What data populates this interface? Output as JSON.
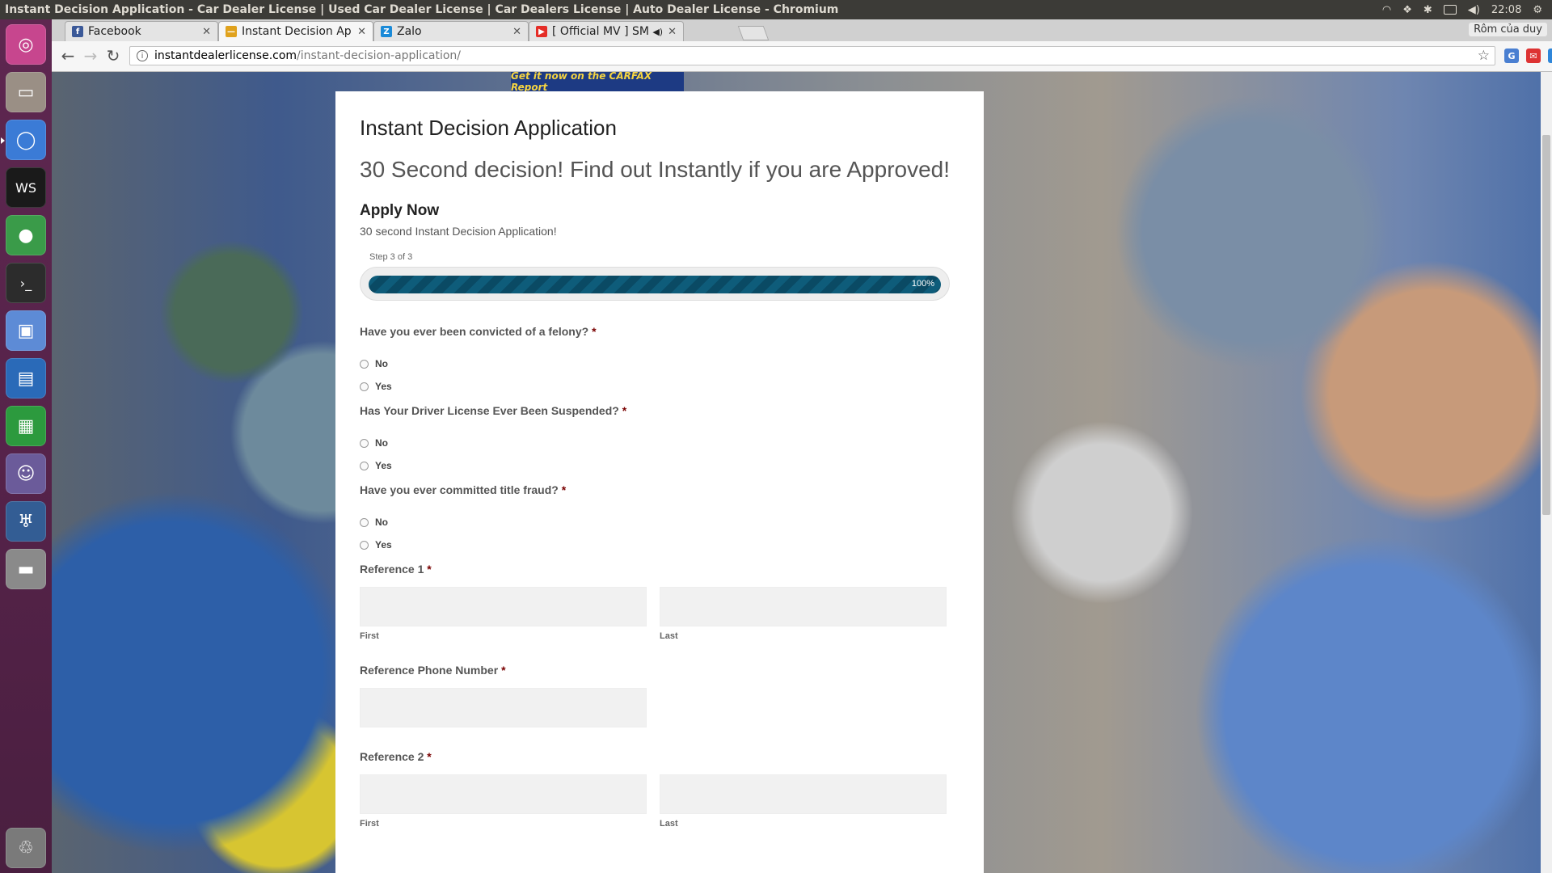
{
  "os": {
    "window_title": "Instant Decision Application - Car Dealer License | Used Car Dealer License | Car Dealers License | Auto Dealer License - Chromium",
    "clock": "22:08"
  },
  "launcher": {
    "apps": [
      {
        "name": "ubuntu-dash-icon",
        "glyph": "◎",
        "color": "#c7468e"
      },
      {
        "name": "files-icon",
        "glyph": "▭",
        "color": "#9a8f85"
      },
      {
        "name": "chromium-icon",
        "glyph": "◯",
        "color": "#3b7bd6"
      },
      {
        "name": "webstorm-icon",
        "glyph": "WS",
        "color": "#1a1a1a"
      },
      {
        "name": "robomongo-icon",
        "glyph": "●",
        "color": "#3a9b49"
      },
      {
        "name": "terminal-icon",
        "glyph": "›_",
        "color": "#2c2c2c"
      },
      {
        "name": "virtualbox-icon",
        "glyph": "▣",
        "color": "#5d8bd6"
      },
      {
        "name": "writer-icon",
        "glyph": "▤",
        "color": "#2a6ab8"
      },
      {
        "name": "calc-icon",
        "glyph": "▦",
        "color": "#2c9a3e"
      },
      {
        "name": "pidgin-icon",
        "glyph": "☺",
        "color": "#6b5b9a"
      },
      {
        "name": "pgadmin-icon",
        "glyph": "♅",
        "color": "#335d94"
      },
      {
        "name": "disk-icon",
        "glyph": "▬",
        "color": "#8a8a8a"
      },
      {
        "name": "trash-icon",
        "glyph": "♲",
        "color": "#7a7a7a"
      }
    ]
  },
  "browser": {
    "tabs": [
      {
        "label": "Facebook",
        "fav": "f",
        "fav_color": "#3b5998"
      },
      {
        "label": "Instant Decision App",
        "fav": "—",
        "fav_color": "#e0a21d"
      },
      {
        "label": "Zalo",
        "fav": "Z",
        "fav_color": "#1a8ad8"
      },
      {
        "label": "[ Official MV ] SM",
        "fav": "▶",
        "fav_color": "#e52d27"
      }
    ],
    "profile": "Rôm của duy",
    "url_domain": "instantdealerlicense.com",
    "url_path": "/instant-decision-application/"
  },
  "background": {
    "sign": "Get it now on the CARFAX Report"
  },
  "page": {
    "title": "Instant Decision Application",
    "subtitle": "30 Second decision! Find out Instantly if you are Approved!",
    "form_title": "Apply Now",
    "form_desc": "30 second Instant Decision Application!",
    "step": "Step 3 of 3",
    "progress": "100%",
    "required_mark": "*",
    "questions": [
      {
        "label": "Have you ever been convicted of a felony?",
        "options": [
          "No",
          "Yes"
        ]
      },
      {
        "label": "Has Your Driver License Ever Been Suspended?",
        "options": [
          "No",
          "Yes"
        ]
      },
      {
        "label": "Have you ever committed title fraud?",
        "options": [
          "No",
          "Yes"
        ]
      }
    ],
    "ref1": {
      "label": "Reference 1",
      "first": "First",
      "last": "Last"
    },
    "ref_phone": {
      "label": "Reference Phone Number"
    },
    "ref2": {
      "label": "Reference 2",
      "first": "First",
      "last": "Last"
    }
  }
}
